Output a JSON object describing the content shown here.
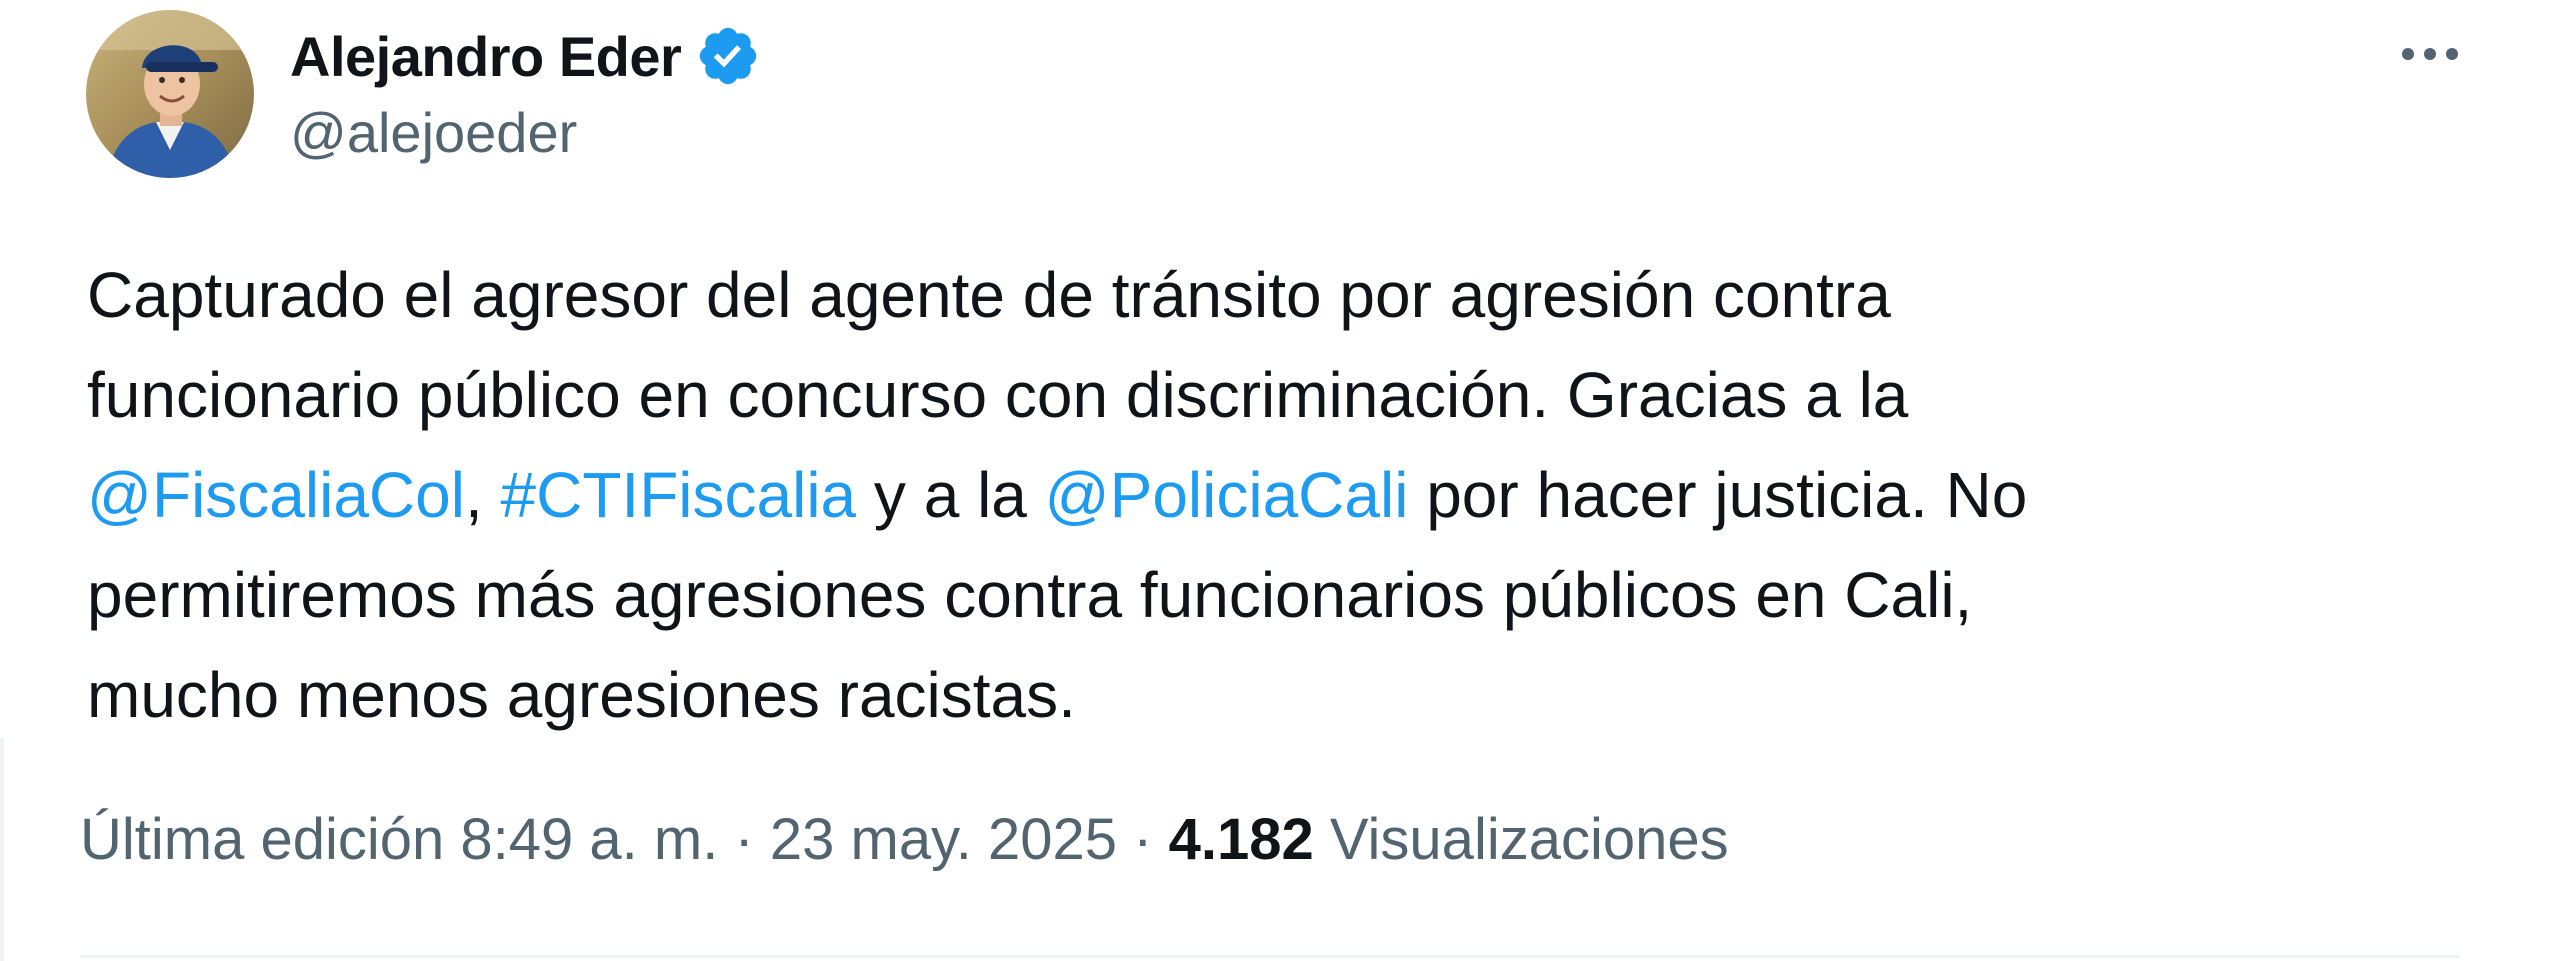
{
  "author": {
    "name": "Alejandro Eder",
    "handle": "@alejoeder",
    "verified": true,
    "avatar_icon": "profile-photo"
  },
  "more_icon": "ellipsis-icon",
  "tweet": {
    "lines": [
      [
        {
          "text": "Capturado el agresor del agente de tránsito por agresión contra",
          "type": "text"
        }
      ],
      [
        {
          "text": "funcionario público en concurso con discriminación. Gracias a la",
          "type": "text"
        }
      ],
      [
        {
          "text": "@FiscaliaCol",
          "type": "mention"
        },
        {
          "text": ", ",
          "type": "text"
        },
        {
          "text": "#CTIFiscalia",
          "type": "hashtag"
        },
        {
          "text": " y a la ",
          "type": "text"
        },
        {
          "text": "@PoliciaCali",
          "type": "mention"
        },
        {
          "text": " por hacer justicia. No",
          "type": "text"
        }
      ],
      [
        {
          "text": "permitiremos más agresiones contra funcionarios públicos en Cali,",
          "type": "text"
        }
      ],
      [
        {
          "text": "mucho menos agresiones racistas.",
          "type": "text"
        }
      ]
    ]
  },
  "meta": {
    "edited_label": "Última edición",
    "time": "8:49 a. m.",
    "separator": "·",
    "date": "23 may. 2025",
    "views_count": "4.182",
    "views_label": "Visualizaciones"
  },
  "colors": {
    "link": "#1d9bf0",
    "text": "#0f1419",
    "secondary": "#536471",
    "verified": "#1d9bf0"
  }
}
